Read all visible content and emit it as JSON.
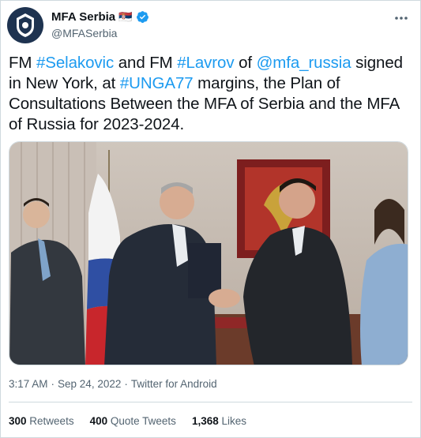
{
  "account": {
    "display_name": "MFA Serbia",
    "flag": "🇷🇸",
    "handle": "@MFASerbia",
    "verified_icon": "verified-badge-icon",
    "avatar_icon": "serbian-coat-of-arms",
    "more_icon": "more-horizontal-icon"
  },
  "tweet": {
    "parts": [
      {
        "text": "FM ",
        "link": false
      },
      {
        "text": "#Selakovic",
        "link": true
      },
      {
        "text": " and FM ",
        "link": false
      },
      {
        "text": "#Lavrov",
        "link": true
      },
      {
        "text": " of ",
        "link": false
      },
      {
        "text": "@mfa_russia",
        "link": true
      },
      {
        "text": " signed in New York, at ",
        "link": false
      },
      {
        "text": "#UNGA77",
        "link": true
      },
      {
        "text": " margins, the Plan of Consultations Between the MFA of Serbia and the MFA of Russia for 2023-2024.",
        "link": false
      }
    ]
  },
  "meta": {
    "time": "3:17 AM",
    "date": "Sep 24, 2022",
    "source": "Twitter for Android",
    "sep": "·"
  },
  "stats": {
    "retweets_count": "300",
    "retweets_label": "Retweets",
    "quotes_count": "400",
    "quotes_label": "Quote Tweets",
    "likes_count": "1,368",
    "likes_label": "Likes"
  },
  "colors": {
    "link": "#1d9bf0",
    "verified": "#1d9bf0",
    "muted": "#536471"
  }
}
